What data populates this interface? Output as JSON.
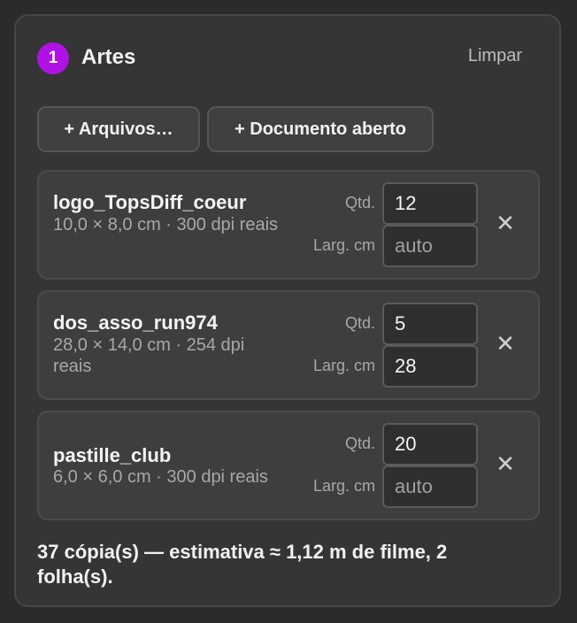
{
  "section": {
    "step": "1",
    "title": "Artes",
    "clear_label": "Limpar"
  },
  "actions": {
    "add_files_label": "+ Arquivos…",
    "add_open_doc_label": "+ Documento aberto"
  },
  "labels": {
    "qty": "Qtd.",
    "width": "Larg. cm",
    "remove_glyph": "✕"
  },
  "items": [
    {
      "name": "logo_TopsDiff_coeur",
      "meta": "10,0 × 8,0 cm · 300 dpi reais",
      "qty": "12",
      "width": "",
      "width_placeholder": "auto"
    },
    {
      "name": "dos_asso_run974",
      "meta": "28,0 × 14,0 cm · 254 dpi reais",
      "qty": "5",
      "width": "28",
      "width_placeholder": "auto"
    },
    {
      "name": "pastille_club",
      "meta": "6,0 × 6,0 cm · 300 dpi reais",
      "qty": "20",
      "width": "",
      "width_placeholder": "auto"
    }
  ],
  "summary": "37 cópia(s) — estimativa ≈ 1,12 m de filme, 2 folha(s).",
  "colors": {
    "accent": "#b012e6",
    "panel_bg": "#353535",
    "page_bg": "#2b2b2b"
  }
}
